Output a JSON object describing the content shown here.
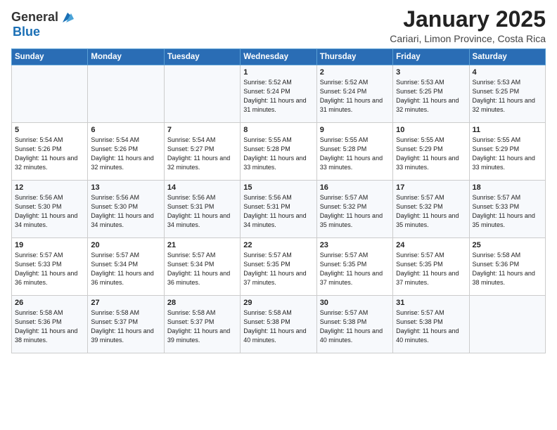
{
  "header": {
    "logo_general": "General",
    "logo_blue": "Blue",
    "title": "January 2025",
    "subtitle": "Cariari, Limon Province, Costa Rica"
  },
  "columns": [
    "Sunday",
    "Monday",
    "Tuesday",
    "Wednesday",
    "Thursday",
    "Friday",
    "Saturday"
  ],
  "weeks": [
    [
      {
        "day": "",
        "info": ""
      },
      {
        "day": "",
        "info": ""
      },
      {
        "day": "",
        "info": ""
      },
      {
        "day": "1",
        "info": "Sunrise: 5:52 AM\nSunset: 5:24 PM\nDaylight: 11 hours and 31 minutes."
      },
      {
        "day": "2",
        "info": "Sunrise: 5:52 AM\nSunset: 5:24 PM\nDaylight: 11 hours and 31 minutes."
      },
      {
        "day": "3",
        "info": "Sunrise: 5:53 AM\nSunset: 5:25 PM\nDaylight: 11 hours and 32 minutes."
      },
      {
        "day": "4",
        "info": "Sunrise: 5:53 AM\nSunset: 5:25 PM\nDaylight: 11 hours and 32 minutes."
      }
    ],
    [
      {
        "day": "5",
        "info": "Sunrise: 5:54 AM\nSunset: 5:26 PM\nDaylight: 11 hours and 32 minutes."
      },
      {
        "day": "6",
        "info": "Sunrise: 5:54 AM\nSunset: 5:26 PM\nDaylight: 11 hours and 32 minutes."
      },
      {
        "day": "7",
        "info": "Sunrise: 5:54 AM\nSunset: 5:27 PM\nDaylight: 11 hours and 32 minutes."
      },
      {
        "day": "8",
        "info": "Sunrise: 5:55 AM\nSunset: 5:28 PM\nDaylight: 11 hours and 33 minutes."
      },
      {
        "day": "9",
        "info": "Sunrise: 5:55 AM\nSunset: 5:28 PM\nDaylight: 11 hours and 33 minutes."
      },
      {
        "day": "10",
        "info": "Sunrise: 5:55 AM\nSunset: 5:29 PM\nDaylight: 11 hours and 33 minutes."
      },
      {
        "day": "11",
        "info": "Sunrise: 5:55 AM\nSunset: 5:29 PM\nDaylight: 11 hours and 33 minutes."
      }
    ],
    [
      {
        "day": "12",
        "info": "Sunrise: 5:56 AM\nSunset: 5:30 PM\nDaylight: 11 hours and 34 minutes."
      },
      {
        "day": "13",
        "info": "Sunrise: 5:56 AM\nSunset: 5:30 PM\nDaylight: 11 hours and 34 minutes."
      },
      {
        "day": "14",
        "info": "Sunrise: 5:56 AM\nSunset: 5:31 PM\nDaylight: 11 hours and 34 minutes."
      },
      {
        "day": "15",
        "info": "Sunrise: 5:56 AM\nSunset: 5:31 PM\nDaylight: 11 hours and 34 minutes."
      },
      {
        "day": "16",
        "info": "Sunrise: 5:57 AM\nSunset: 5:32 PM\nDaylight: 11 hours and 35 minutes."
      },
      {
        "day": "17",
        "info": "Sunrise: 5:57 AM\nSunset: 5:32 PM\nDaylight: 11 hours and 35 minutes."
      },
      {
        "day": "18",
        "info": "Sunrise: 5:57 AM\nSunset: 5:33 PM\nDaylight: 11 hours and 35 minutes."
      }
    ],
    [
      {
        "day": "19",
        "info": "Sunrise: 5:57 AM\nSunset: 5:33 PM\nDaylight: 11 hours and 36 minutes."
      },
      {
        "day": "20",
        "info": "Sunrise: 5:57 AM\nSunset: 5:34 PM\nDaylight: 11 hours and 36 minutes."
      },
      {
        "day": "21",
        "info": "Sunrise: 5:57 AM\nSunset: 5:34 PM\nDaylight: 11 hours and 36 minutes."
      },
      {
        "day": "22",
        "info": "Sunrise: 5:57 AM\nSunset: 5:35 PM\nDaylight: 11 hours and 37 minutes."
      },
      {
        "day": "23",
        "info": "Sunrise: 5:57 AM\nSunset: 5:35 PM\nDaylight: 11 hours and 37 minutes."
      },
      {
        "day": "24",
        "info": "Sunrise: 5:57 AM\nSunset: 5:35 PM\nDaylight: 11 hours and 37 minutes."
      },
      {
        "day": "25",
        "info": "Sunrise: 5:58 AM\nSunset: 5:36 PM\nDaylight: 11 hours and 38 minutes."
      }
    ],
    [
      {
        "day": "26",
        "info": "Sunrise: 5:58 AM\nSunset: 5:36 PM\nDaylight: 11 hours and 38 minutes."
      },
      {
        "day": "27",
        "info": "Sunrise: 5:58 AM\nSunset: 5:37 PM\nDaylight: 11 hours and 39 minutes."
      },
      {
        "day": "28",
        "info": "Sunrise: 5:58 AM\nSunset: 5:37 PM\nDaylight: 11 hours and 39 minutes."
      },
      {
        "day": "29",
        "info": "Sunrise: 5:58 AM\nSunset: 5:38 PM\nDaylight: 11 hours and 40 minutes."
      },
      {
        "day": "30",
        "info": "Sunrise: 5:57 AM\nSunset: 5:38 PM\nDaylight: 11 hours and 40 minutes."
      },
      {
        "day": "31",
        "info": "Sunrise: 5:57 AM\nSunset: 5:38 PM\nDaylight: 11 hours and 40 minutes."
      },
      {
        "day": "",
        "info": ""
      }
    ]
  ]
}
